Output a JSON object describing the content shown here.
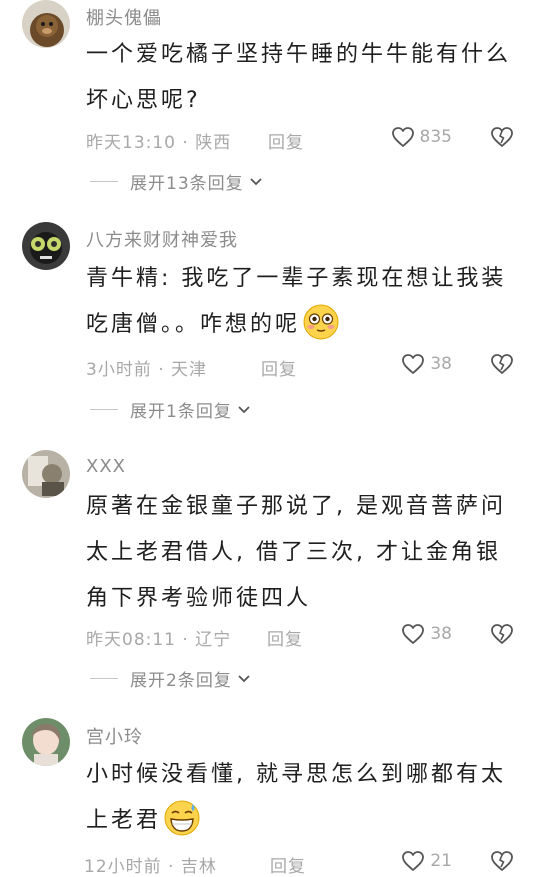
{
  "comments": [
    {
      "username": "棚头傀儡",
      "text": "一个爱吃橘子坚持午睡的牛牛能有什么坏心思呢?",
      "emoji": "",
      "time": "昨天13:10 · 陕西",
      "reply": "回复",
      "likes": "835",
      "expand": "展开13条回复"
    },
    {
      "username": "八方来财财神爱我",
      "text": "青牛精: 我吃了一辈子素现在想让我装吃唐僧。。咋想的呢",
      "emoji": "flushed-emoji",
      "time": "3小时前 · 天津",
      "reply": "回复",
      "likes": "38",
      "expand": "展开1条回复"
    },
    {
      "username": "XXX",
      "text": "原著在金银童子那说了, 是观音菩萨问太上老君借人, 借了三次, 才让金角银角下界考验师徒四人",
      "emoji": "",
      "time": "昨天08:11 · 辽宁",
      "reply": "回复",
      "likes": "38",
      "expand": "展开2条回复"
    },
    {
      "username": "宫小玲",
      "text": "小时候没看懂, 就寻思怎么到哪都有太上老君",
      "emoji": "sweat-smile-emoji",
      "time": "12小时前 · 吉林",
      "reply": "回复",
      "likes": "21",
      "expand": ""
    }
  ],
  "icons": {
    "like": "heart-outline-icon",
    "dislike": "broken-heart-icon",
    "expand": "chevron-down-icon"
  },
  "colors": {
    "text": "#1f1f1f",
    "muted": "#a8a8a8",
    "emoji_face": "#fcd34d"
  }
}
